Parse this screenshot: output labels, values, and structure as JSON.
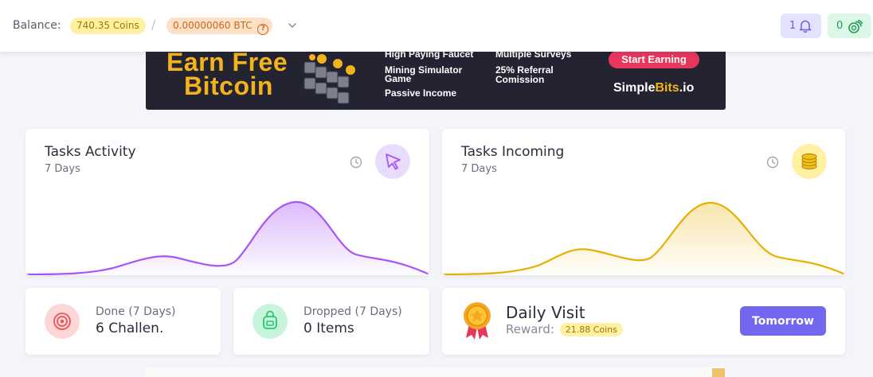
{
  "header": {
    "balance_label": "Balance:",
    "coins": "740.35 Coins",
    "separator": "/",
    "btc": "0.00000060 BTC",
    "btc_help_icon": "?",
    "dropdown_icon": "chevron-down-icon",
    "notifications_count": "1",
    "notifications_icon": "bell-icon",
    "coins_count": "0",
    "coins_icon": "coins-icon"
  },
  "banner": {
    "headline_line1": "Earn Free",
    "headline_line2": "Bitcoin",
    "features_col1": [
      "High Paying Faucet",
      "Mining Simulator",
      "Game",
      "Passive Income"
    ],
    "features_col2": [
      "Multiple Surveys",
      "25% Referral",
      "Comission"
    ],
    "cta": "Start Earning",
    "brand_main": "Simple",
    "brand_accent": "Bits",
    "brand_tld": ".io"
  },
  "cards": {
    "tasks_activity": {
      "title": "Tasks Activity",
      "subtitle": "7 Days",
      "icon": "cursor-icon",
      "color": "#a855f7"
    },
    "tasks_incoming": {
      "title": "Tasks Incoming",
      "subtitle": "7 Days",
      "icon": "coins-stack-icon",
      "color": "#e6b000"
    }
  },
  "stats": {
    "done": {
      "label": "Done (7 Days)",
      "value": "6 Challen.",
      "icon": "target-icon"
    },
    "dropped": {
      "label": "Dropped (7 Days)",
      "value": "0 Items",
      "icon": "backpack-icon"
    }
  },
  "daily_visit": {
    "title": "Daily Visit",
    "reward_label": "Reward:",
    "reward_value": "21.88 Coins",
    "button": "Tomorrow",
    "icon": "medal-icon"
  },
  "colors": {
    "primary": "#7367f0",
    "coins_pill_bg": "#fff0a3",
    "btc_pill_bg": "#fde0c6",
    "danger": "#e8365d"
  }
}
